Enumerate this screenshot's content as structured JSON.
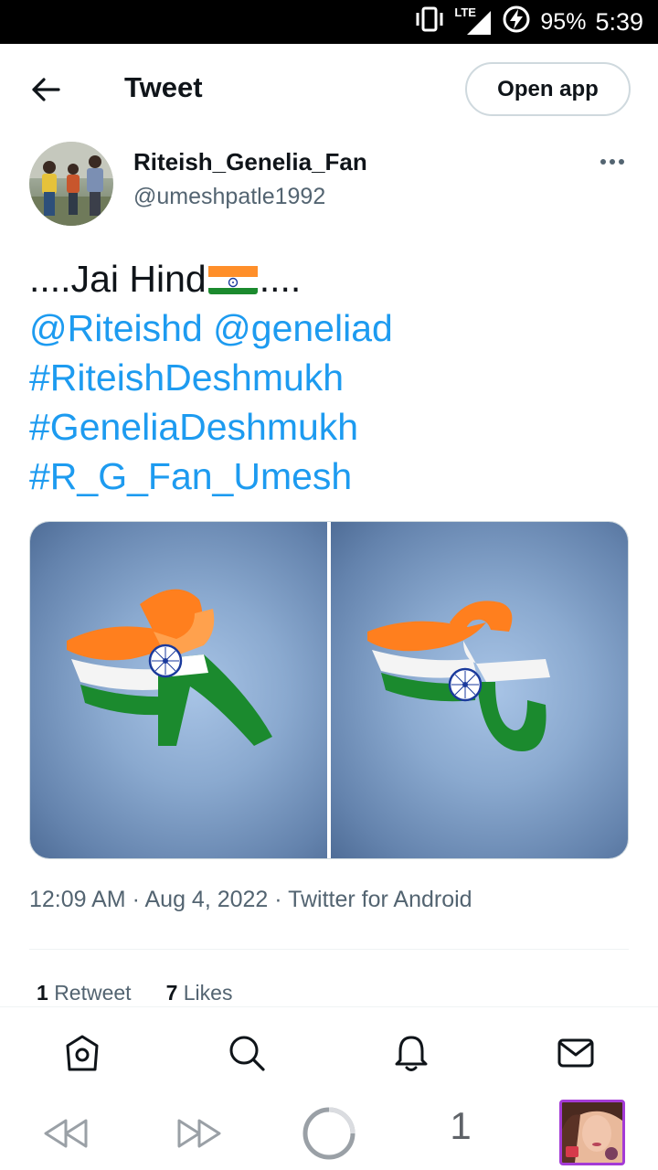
{
  "status_bar": {
    "network": "LTE",
    "battery": "95%",
    "time": "5:39"
  },
  "header": {
    "title": "Tweet",
    "open_app_label": "Open app"
  },
  "author": {
    "display_name": "Riteish_Genelia_Fan",
    "handle": "@umeshpatle1992"
  },
  "tweet": {
    "line1_prefix": "....Jai Hind",
    "line1_suffix": "....",
    "mention1": "@Riteishd",
    "mention2": "@geneliad",
    "hashtag1": "#RiteishDeshmukh",
    "hashtag2": "#GeneliaDeshmukh",
    "hashtag3": "#R_G_Fan_Umesh"
  },
  "media": {
    "image1_letter": "R",
    "image2_letter": "G"
  },
  "meta": {
    "time": "12:09 AM",
    "date": "Aug 4, 2022",
    "source": "Twitter for Android",
    "separator": " · "
  },
  "stats": {
    "retweets_count": "1",
    "retweets_label": "Retweet",
    "likes_count": "7",
    "likes_label": "Likes"
  },
  "browser": {
    "tab_count": "1"
  },
  "colors": {
    "accent": "#1d9bf0",
    "text_primary": "#0f1419",
    "text_secondary": "#536471",
    "saffron": "#ff7f1e",
    "india_green": "#1b8a2e"
  }
}
